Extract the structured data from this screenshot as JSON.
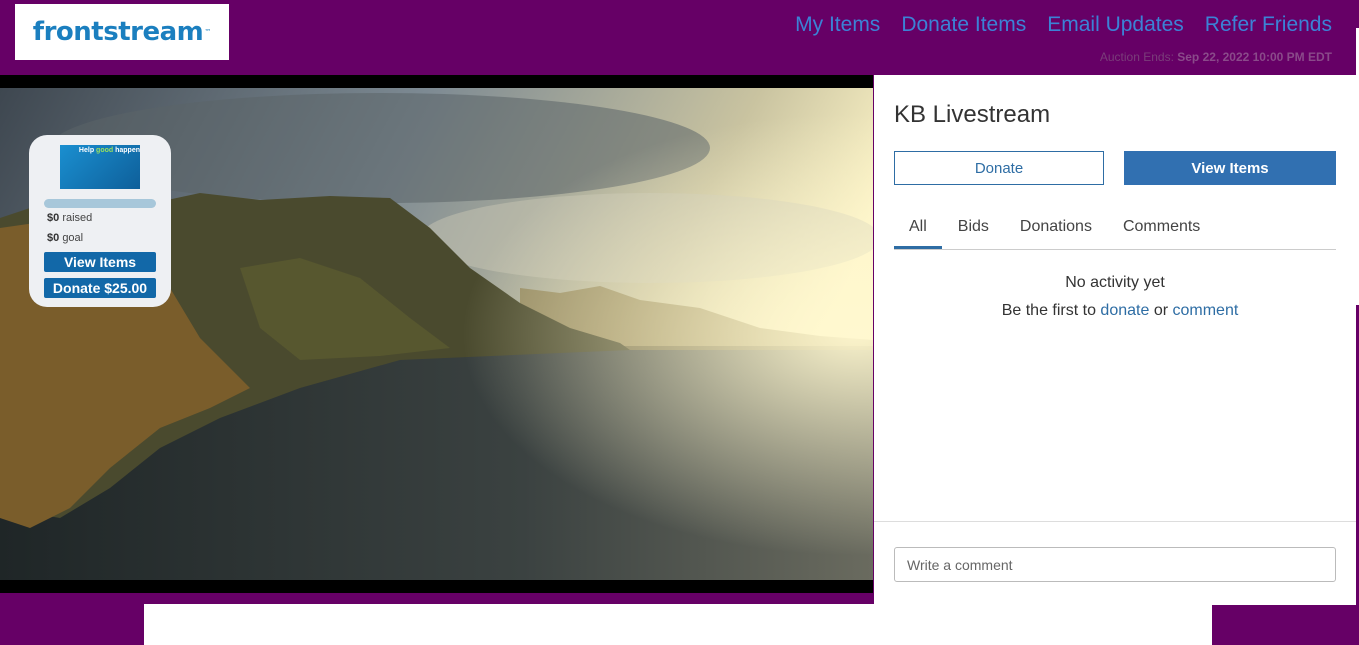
{
  "header": {
    "logo_text": "frontstream",
    "logo_tm": "™",
    "nav": [
      "My Items",
      "Donate Items",
      "Email Updates",
      "Refer Friends"
    ],
    "auction_label": "Auction Ends:",
    "auction_date": "Sep 22, 2022 10:00 PM EDT"
  },
  "overlay": {
    "thumb_text_a": "Help ",
    "thumb_text_good": "good",
    "thumb_text_b": " happen",
    "raised_amount": "$0",
    "raised_label": "raised",
    "goal_amount": "$0",
    "goal_label": "goal",
    "progress": 0,
    "view_items_label": "View Items",
    "donate_label": "Donate $25.00"
  },
  "panel": {
    "title": "KB Livestream",
    "donate_label": "Donate",
    "view_items_label": "View Items",
    "tabs": [
      "All",
      "Bids",
      "Donations",
      "Comments"
    ],
    "active_tab": "All",
    "empty_title": "No activity yet",
    "empty_prefix": "Be the first to",
    "empty_donate_link": "donate",
    "empty_or": "or",
    "empty_comment_link": "comment",
    "comment_placeholder": "Write a comment"
  },
  "colors": {
    "header_bg": "#660066",
    "brand_blue": "#1b7fbf",
    "nav_link": "#3b82d6",
    "primary": "#3170b1"
  },
  "icons": [
    "meditation-logo-icon"
  ]
}
